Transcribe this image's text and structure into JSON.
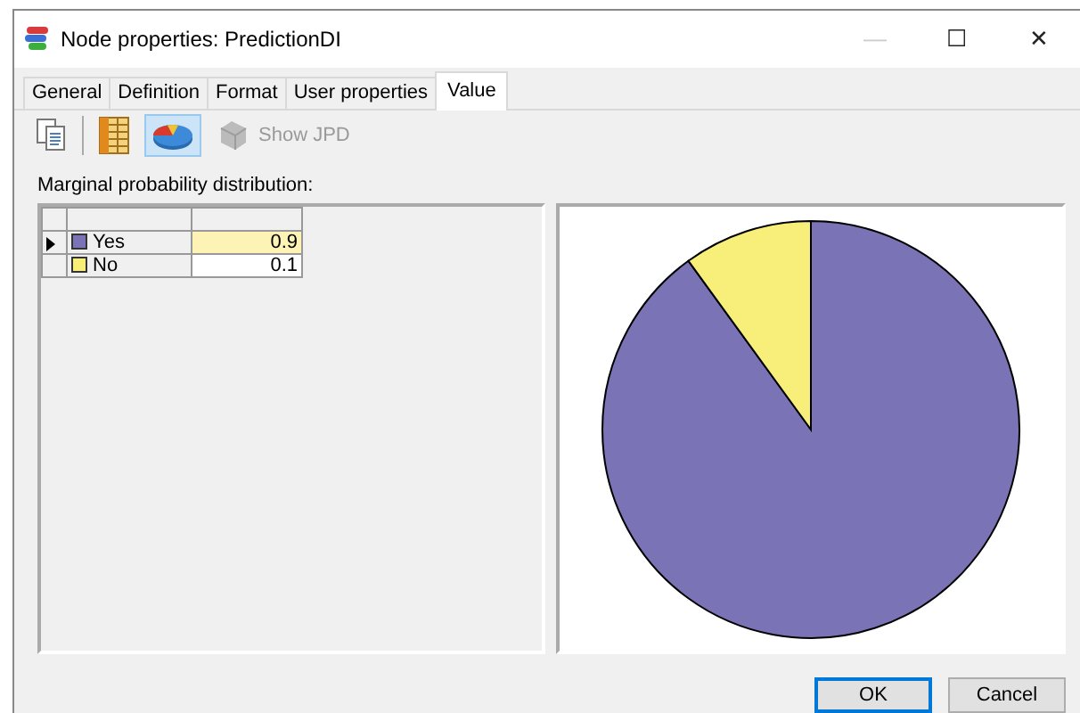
{
  "window": {
    "title": "Node properties: PredictionDI",
    "controls": [
      "—",
      "☐",
      "✕"
    ]
  },
  "tabs": [
    {
      "label": "General",
      "selected": false
    },
    {
      "label": "Definition",
      "selected": false
    },
    {
      "label": "Format",
      "selected": false
    },
    {
      "label": "User properties",
      "selected": false
    },
    {
      "label": "Value",
      "selected": true
    }
  ],
  "toolbar": [
    {
      "kind": "copy",
      "selected": false,
      "disabled": false
    },
    {
      "kind": "separator"
    },
    {
      "kind": "bars",
      "selected": false,
      "disabled": false
    },
    {
      "kind": "pie",
      "selected": true,
      "disabled": false
    },
    {
      "kind": "jpd",
      "label": "Show JPD",
      "selected": false,
      "disabled": true
    }
  ],
  "section_label": "Marginal probability distribution:",
  "table": {
    "rows": [
      {
        "state": "Yes",
        "value": "0.9",
        "color": "#7a73b5",
        "selected": true
      },
      {
        "state": "No",
        "value": "0.1",
        "color": "#f7ef7a",
        "selected": false
      }
    ]
  },
  "chart_data": {
    "type": "pie",
    "series": [
      {
        "values": [
          0.9,
          0.1
        ]
      }
    ]
  },
  "buttons": [
    {
      "label": "OK",
      "default": true
    },
    {
      "label": "Cancel",
      "default": false
    }
  ]
}
